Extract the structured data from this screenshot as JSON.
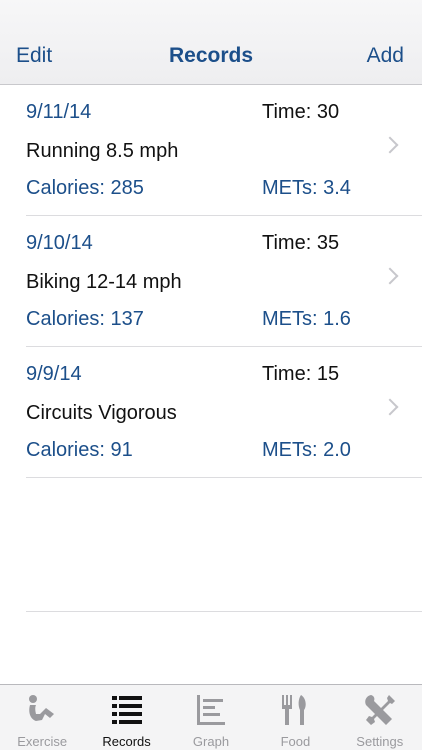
{
  "nav": {
    "left": "Edit",
    "title": "Records",
    "right": "Add"
  },
  "records": [
    {
      "date": "9/11/14",
      "time": "Time: 30",
      "activity": "Running 8.5 mph",
      "calories": "Calories: 285",
      "mets": "METs: 3.4"
    },
    {
      "date": "9/10/14",
      "time": "Time: 35",
      "activity": "Biking 12-14 mph",
      "calories": "Calories: 137",
      "mets": "METs: 1.6"
    },
    {
      "date": "9/9/14",
      "time": "Time: 15",
      "activity": "Circuits Vigorous",
      "calories": "Calories: 91",
      "mets": "METs: 2.0"
    }
  ],
  "tabs": [
    {
      "label": "Exercise",
      "icon": "exercise-icon"
    },
    {
      "label": "Records",
      "icon": "list-icon"
    },
    {
      "label": "Graph",
      "icon": "graph-icon"
    },
    {
      "label": "Food",
      "icon": "fork-knife-icon"
    },
    {
      "label": "Settings",
      "icon": "wrench-screwdriver-icon"
    }
  ],
  "active_tab": "Records",
  "colors": {
    "accent": "#1c4f8a",
    "inactive_tab": "#9a9a9e"
  }
}
